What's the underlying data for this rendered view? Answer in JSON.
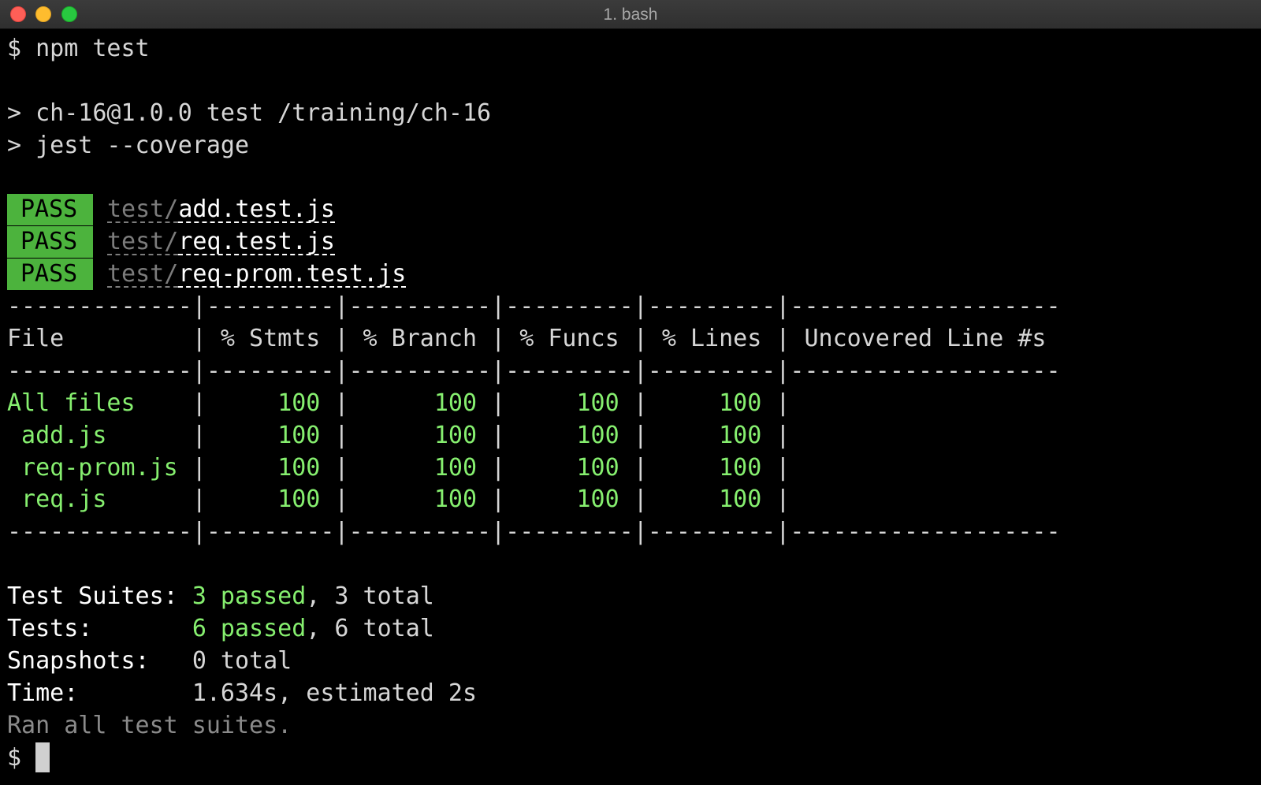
{
  "window": {
    "title": "1. bash"
  },
  "terminal": {
    "command": "$ npm test",
    "script_line": "> ch-16@1.0.0 test /training/ch-16",
    "jest_line": "> jest --coverage",
    "results": [
      {
        "status": "PASS",
        "dir": "test/",
        "file": "add.test.js"
      },
      {
        "status": "PASS",
        "dir": "test/",
        "file": "req.test.js"
      },
      {
        "status": "PASS",
        "dir": "test/",
        "file": "req-prom.test.js"
      }
    ],
    "coverage": {
      "separator": "-------------|---------|----------|---------|---------|-------------------",
      "header": "File         | % Stmts | % Branch | % Funcs | % Lines | Uncovered Line #s",
      "rows": [
        {
          "file": "All files   ",
          "stmts": "100",
          "branch": "100",
          "funcs": "100",
          "lines": "100",
          "uncovered": ""
        },
        {
          "file": " add.js     ",
          "stmts": "100",
          "branch": "100",
          "funcs": "100",
          "lines": "100",
          "uncovered": ""
        },
        {
          "file": " req-prom.js",
          "stmts": "100",
          "branch": "100",
          "funcs": "100",
          "lines": "100",
          "uncovered": ""
        },
        {
          "file": " req.js     ",
          "stmts": "100",
          "branch": "100",
          "funcs": "100",
          "lines": "100",
          "uncovered": ""
        }
      ]
    },
    "summary": {
      "suites_label": "Test Suites:",
      "suites_passed": "3 passed",
      "suites_total": ", 3 total",
      "tests_label": "Tests:",
      "tests_passed": "6 passed",
      "tests_total": ", 6 total",
      "snapshots_label": "Snapshots:",
      "snapshots_value": "0 total",
      "time_label": "Time:",
      "time_value": "1.634s, estimated 2s",
      "ran_all": "Ran all test suites."
    },
    "prompt": "$"
  },
  "colors": {
    "pass_badge": "#4cb33d",
    "coverage_green": "#86ef6f",
    "text": "#d6d6d6",
    "background": "#000000"
  }
}
